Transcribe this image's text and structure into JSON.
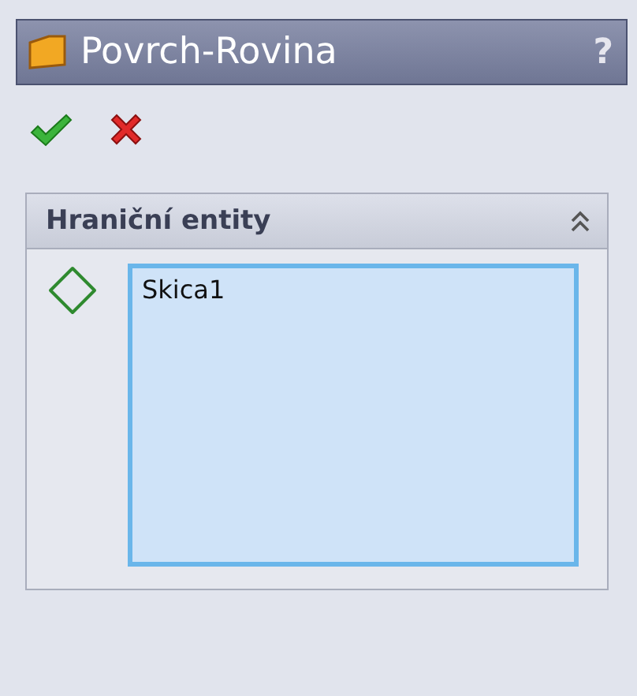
{
  "title_bar": {
    "title": "Povrch-Rovina",
    "help": "?"
  },
  "group": {
    "title": "Hraniční entity",
    "expanded": true,
    "selection_list": {
      "items": [
        "Skica1"
      ]
    }
  }
}
